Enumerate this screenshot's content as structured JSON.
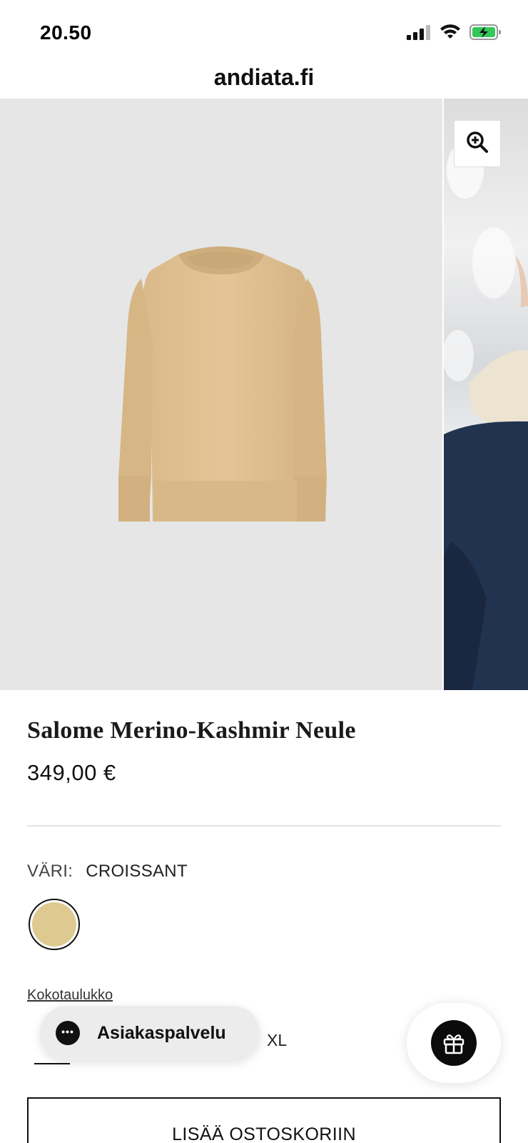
{
  "status_bar": {
    "time": "20.50",
    "icons": [
      "signal-icon",
      "wifi-icon",
      "battery-charging-icon"
    ]
  },
  "browser": {
    "url": "andiata.fi"
  },
  "gallery": {
    "main_image": "sweater-product-photo",
    "next_image": "model-photo-partial",
    "zoom_icon": "zoom-in-icon"
  },
  "product": {
    "title": "Salome Merino-Kashmir Neule",
    "price": "349,00 €",
    "color_label": "VÄRI:",
    "color_value": "CROISSANT",
    "swatch_color": "#dec991",
    "size_chart_link": "Kokotaulukko",
    "size_visible": "XL",
    "add_to_cart": "LISÄÄ OSTOSKORIIN"
  },
  "widgets": {
    "customer_service_label": "Asiakaspalvelu",
    "chat_icon": "chat-bubble-icon",
    "gift_icon": "gift-icon"
  },
  "colors": {
    "gallery_bg": "#e6e6e6",
    "text": "#111111"
  }
}
